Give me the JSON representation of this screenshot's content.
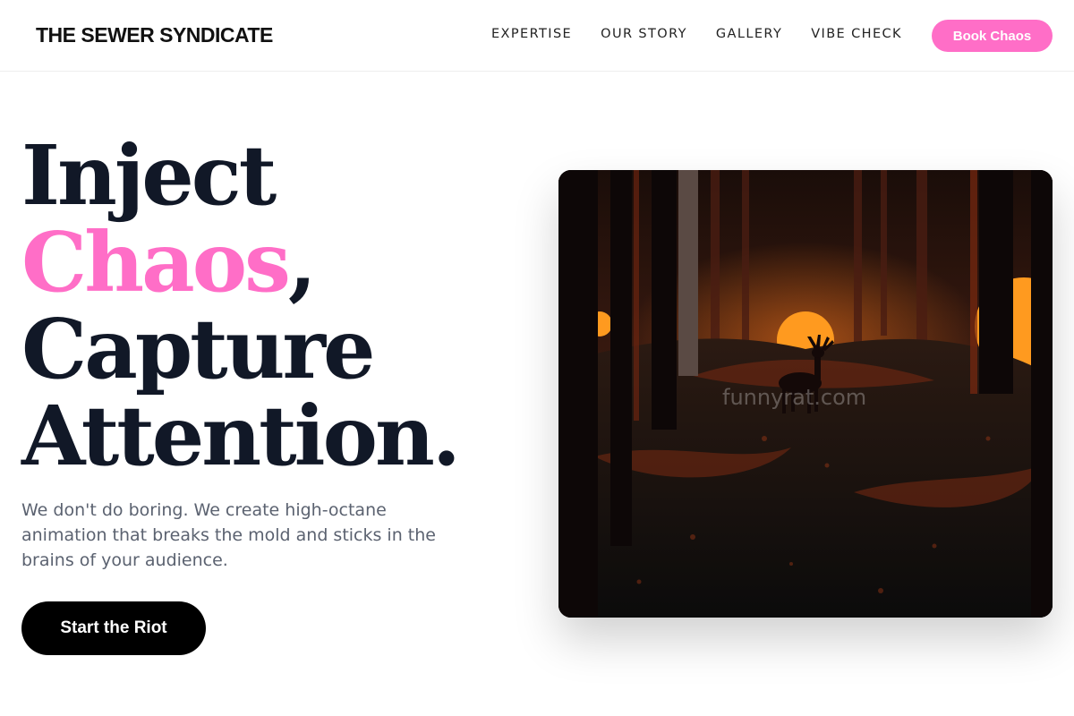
{
  "header": {
    "logo": "THE SEWER SYNDICATE",
    "nav": [
      "EXPERTISE",
      "OUR STORY",
      "GALLERY",
      "VIBE CHECK"
    ],
    "cta_label": "Book Chaos"
  },
  "hero": {
    "headline": {
      "line1": "Inject",
      "line2_accent": "Chaos",
      "line2_rest": ",",
      "line3": "Capture",
      "line4": "Attention."
    },
    "subcopy": "We don't do boring. We create high-octane animation that breaks the mold and sticks in the brains of your audience.",
    "cta_label": "Start the Riot",
    "image_watermark": "funnyrat.com"
  },
  "colors": {
    "accent": "#ff6ec7",
    "headline": "#111827",
    "body_text": "#5b6270",
    "cta_background": "#000000"
  }
}
